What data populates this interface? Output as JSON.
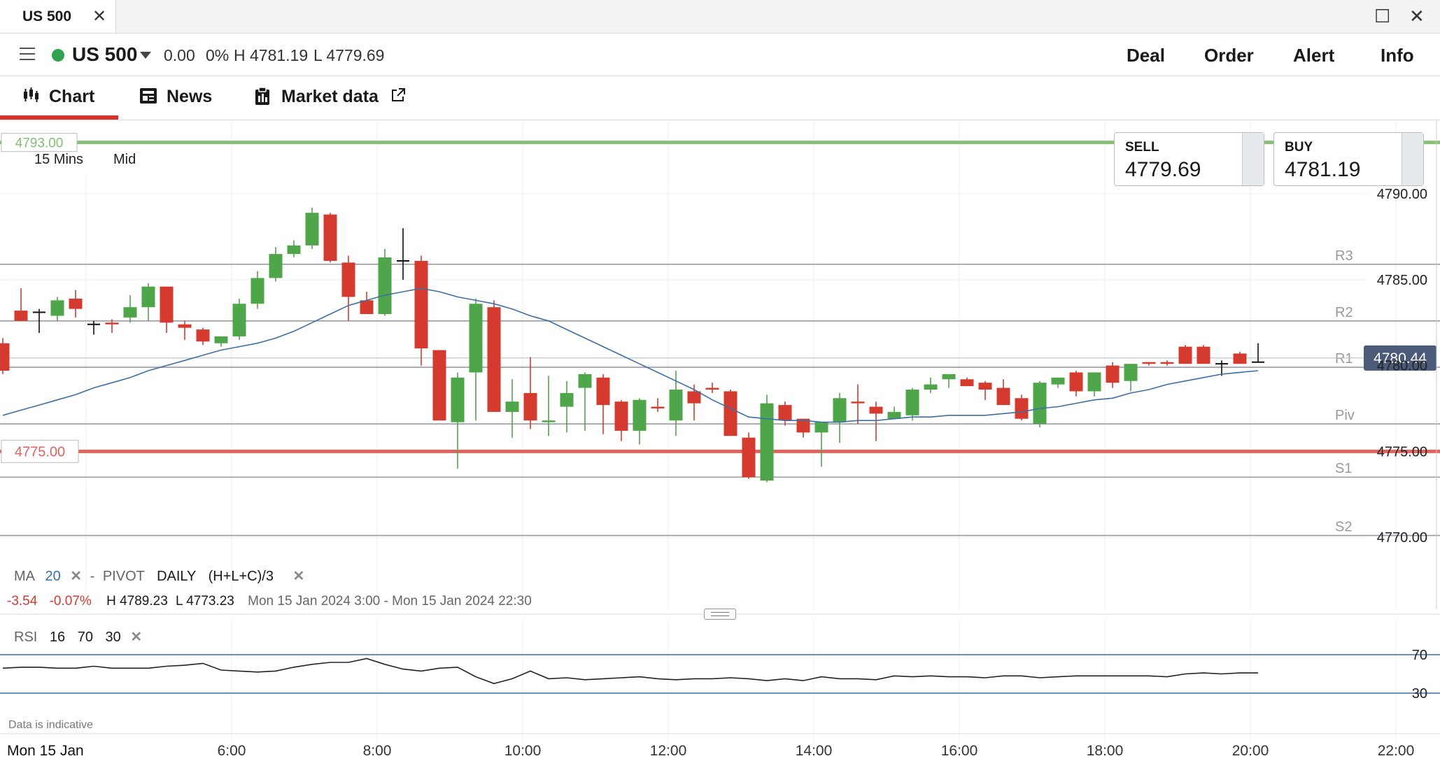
{
  "window": {
    "tab_title": "US 500",
    "close_glyph": "✕",
    "maximize_glyph": "☐",
    "window_close_glyph": "✕"
  },
  "header": {
    "instrument": "US 500",
    "change": "0.00",
    "change_pct": "0%",
    "high": "H 4781.19",
    "low": "L 4779.69",
    "actions": [
      "Deal",
      "Order",
      "Alert",
      "Info"
    ],
    "status_color": "#2ea44f"
  },
  "tabs": [
    {
      "label": "Chart",
      "icon": "candlestick-icon",
      "active": true
    },
    {
      "label": "News",
      "icon": "newspaper-icon"
    },
    {
      "label": "Market data",
      "icon": "clipboard-icon",
      "external": "external-link-icon"
    }
  ],
  "ticket": {
    "sell_label": "SELL",
    "sell_price": "4779.69",
    "buy_label": "BUY",
    "buy_price": "4781.19"
  },
  "toolbar": {
    "timeframe": "15 Mins",
    "price_type": "Mid"
  },
  "indicators": {
    "ma_label": "MA",
    "ma_period": "20",
    "pivot_label": "PIVOT",
    "pivot_period": "DAILY",
    "pivot_formula": "(H+L+C)/3",
    "change": "-3.54",
    "change_pct": "-0.07%",
    "high": "H 4789.23",
    "low": "L 4773.23",
    "range": "Mon 15 Jan 2024 3:00 - Mon 15 Jan 2024 22:30",
    "rsi_label": "RSI",
    "rsi_period": "16",
    "rsi_upper": "70",
    "rsi_lower": "30"
  },
  "footer": {
    "note": "Data is indicative",
    "date_label": "Mon 15 Jan"
  },
  "chart_data": {
    "type": "candlestick",
    "interval": "15 Mins",
    "ylim": [
      4767.8,
      4793.8
    ],
    "y_ticks": [
      "4790.00",
      "4785.00",
      "4780.00",
      "4775.00",
      "4770.00"
    ],
    "x_ticks": [
      "6:00",
      "8:00",
      "10:00",
      "12:00",
      "14:00",
      "16:00",
      "18:00",
      "20:00",
      "22:00"
    ],
    "horizontal_levels": [
      {
        "label": "4793.00",
        "value": 4793.0,
        "color": "#86bf75"
      },
      {
        "label": "4775.00",
        "value": 4775.0,
        "color": "#e0635e"
      },
      {
        "label": "4780.44",
        "value": 4780.44,
        "color": "#4a5a78"
      }
    ],
    "pivots": [
      {
        "name": "R3",
        "value": 4785.9
      },
      {
        "name": "R2",
        "value": 4782.6
      },
      {
        "name": "R1",
        "value": 4779.9
      },
      {
        "name": "Piv",
        "value": 4776.6
      },
      {
        "name": "S1",
        "value": 4773.5
      },
      {
        "name": "S2",
        "value": 4770.1
      }
    ],
    "colors": {
      "up": "#4ea54a",
      "down": "#d53a2e",
      "ma": "#3d6fa3",
      "rsi": "#222222"
    },
    "candles": [
      {
        "o": 4781.3,
        "h": 4781.6,
        "l": 4779.5,
        "c": 4779.7
      },
      {
        "o": 4783.2,
        "h": 4784.5,
        "l": 4782.6,
        "c": 4782.6
      },
      {
        "o": 4783.1,
        "h": 4783.3,
        "l": 4781.9,
        "c": 4783.1
      },
      {
        "o": 4782.9,
        "h": 4784.0,
        "l": 4782.6,
        "c": 4783.8
      },
      {
        "o": 4783.9,
        "h": 4784.4,
        "l": 4782.8,
        "c": 4783.3
      },
      {
        "o": 4782.4,
        "h": 4782.6,
        "l": 4781.8,
        "c": 4782.4
      },
      {
        "o": 4782.5,
        "h": 4782.7,
        "l": 4781.9,
        "c": 4782.4
      },
      {
        "o": 4782.8,
        "h": 4784.1,
        "l": 4782.5,
        "c": 4783.4
      },
      {
        "o": 4783.4,
        "h": 4784.8,
        "l": 4782.6,
        "c": 4784.6
      },
      {
        "o": 4784.6,
        "h": 4784.6,
        "l": 4781.9,
        "c": 4782.5
      },
      {
        "o": 4782.4,
        "h": 4782.6,
        "l": 4781.5,
        "c": 4782.2
      },
      {
        "o": 4782.1,
        "h": 4782.2,
        "l": 4781.2,
        "c": 4781.4
      },
      {
        "o": 4781.3,
        "h": 4781.7,
        "l": 4781.1,
        "c": 4781.7
      },
      {
        "o": 4781.7,
        "h": 4783.9,
        "l": 4781.5,
        "c": 4783.6
      },
      {
        "o": 4783.6,
        "h": 4785.5,
        "l": 4783.3,
        "c": 4785.1
      },
      {
        "o": 4785.1,
        "h": 4786.9,
        "l": 4784.9,
        "c": 4786.5
      },
      {
        "o": 4786.5,
        "h": 4787.3,
        "l": 4786.3,
        "c": 4787.0
      },
      {
        "o": 4787.0,
        "h": 4789.2,
        "l": 4786.8,
        "c": 4788.9
      },
      {
        "o": 4788.8,
        "h": 4788.9,
        "l": 4786.0,
        "c": 4786.1
      },
      {
        "o": 4786.0,
        "h": 4786.4,
        "l": 4782.6,
        "c": 4784.0
      },
      {
        "o": 4783.8,
        "h": 4784.3,
        "l": 4783.0,
        "c": 4783.0
      },
      {
        "o": 4783.0,
        "h": 4786.8,
        "l": 4782.9,
        "c": 4786.3
      },
      {
        "o": 4786.1,
        "h": 4788.0,
        "l": 4785.0,
        "c": 4786.1
      },
      {
        "o": 4786.1,
        "h": 4786.4,
        "l": 4780.0,
        "c": 4781.0
      },
      {
        "o": 4780.9,
        "h": 4780.9,
        "l": 4776.8,
        "c": 4776.8
      },
      {
        "o": 4776.7,
        "h": 4779.6,
        "l": 4774.0,
        "c": 4779.3
      },
      {
        "o": 4779.6,
        "h": 4783.9,
        "l": 4776.8,
        "c": 4783.6
      },
      {
        "o": 4783.4,
        "h": 4783.8,
        "l": 4777.3,
        "c": 4777.3
      },
      {
        "o": 4777.3,
        "h": 4779.2,
        "l": 4775.8,
        "c": 4777.9
      },
      {
        "o": 4778.4,
        "h": 4780.5,
        "l": 4776.3,
        "c": 4776.8
      },
      {
        "o": 4776.7,
        "h": 4779.4,
        "l": 4775.9,
        "c": 4776.8
      },
      {
        "o": 4777.6,
        "h": 4779.1,
        "l": 4776.1,
        "c": 4778.4
      },
      {
        "o": 4778.7,
        "h": 4779.6,
        "l": 4776.2,
        "c": 4779.5
      },
      {
        "o": 4779.3,
        "h": 4779.5,
        "l": 4776.0,
        "c": 4777.7
      },
      {
        "o": 4777.9,
        "h": 4778.0,
        "l": 4775.6,
        "c": 4776.2
      },
      {
        "o": 4776.2,
        "h": 4778.1,
        "l": 4775.4,
        "c": 4778.0
      },
      {
        "o": 4777.6,
        "h": 4778.1,
        "l": 4777.3,
        "c": 4777.5
      },
      {
        "o": 4776.8,
        "h": 4779.7,
        "l": 4775.9,
        "c": 4778.6
      },
      {
        "o": 4778.5,
        "h": 4778.9,
        "l": 4776.8,
        "c": 4777.8
      },
      {
        "o": 4778.7,
        "h": 4779.0,
        "l": 4778.4,
        "c": 4778.6
      },
      {
        "o": 4778.5,
        "h": 4778.6,
        "l": 4775.9,
        "c": 4775.9
      },
      {
        "o": 4775.8,
        "h": 4776.1,
        "l": 4773.4,
        "c": 4773.5
      },
      {
        "o": 4773.3,
        "h": 4778.3,
        "l": 4773.2,
        "c": 4777.8
      },
      {
        "o": 4777.7,
        "h": 4777.9,
        "l": 4776.5,
        "c": 4776.8
      },
      {
        "o": 4776.9,
        "h": 4776.9,
        "l": 4775.8,
        "c": 4776.1
      },
      {
        "o": 4776.1,
        "h": 4776.7,
        "l": 4774.1,
        "c": 4776.7
      },
      {
        "o": 4776.7,
        "h": 4778.4,
        "l": 4775.5,
        "c": 4778.1
      },
      {
        "o": 4777.9,
        "h": 4778.9,
        "l": 4776.6,
        "c": 4777.8
      },
      {
        "o": 4777.6,
        "h": 4777.9,
        "l": 4775.6,
        "c": 4777.2
      },
      {
        "o": 4776.9,
        "h": 4777.6,
        "l": 4776.9,
        "c": 4777.3
      },
      {
        "o": 4777.1,
        "h": 4778.7,
        "l": 4776.8,
        "c": 4778.6
      },
      {
        "o": 4778.6,
        "h": 4779.3,
        "l": 4778.4,
        "c": 4778.9
      },
      {
        "o": 4779.2,
        "h": 4779.4,
        "l": 4778.7,
        "c": 4779.5
      },
      {
        "o": 4779.2,
        "h": 4779.3,
        "l": 4778.8,
        "c": 4778.8
      },
      {
        "o": 4779.0,
        "h": 4779.1,
        "l": 4778.0,
        "c": 4778.6
      },
      {
        "o": 4778.7,
        "h": 4779.2,
        "l": 4777.7,
        "c": 4777.7
      },
      {
        "o": 4778.1,
        "h": 4778.3,
        "l": 4776.8,
        "c": 4776.9
      },
      {
        "o": 4776.6,
        "h": 4779.1,
        "l": 4776.4,
        "c": 4779.0
      },
      {
        "o": 4778.9,
        "h": 4779.3,
        "l": 4778.7,
        "c": 4779.3
      },
      {
        "o": 4779.6,
        "h": 4779.7,
        "l": 4778.2,
        "c": 4778.5
      },
      {
        "o": 4778.5,
        "h": 4779.6,
        "l": 4778.2,
        "c": 4779.6
      },
      {
        "o": 4780.0,
        "h": 4780.2,
        "l": 4778.7,
        "c": 4779.0
      },
      {
        "o": 4779.1,
        "h": 4780.1,
        "l": 4778.5,
        "c": 4780.1
      },
      {
        "o": 4780.2,
        "h": 4780.2,
        "l": 4780.0,
        "c": 4780.1
      },
      {
        "o": 4780.2,
        "h": 4780.3,
        "l": 4780.0,
        "c": 4780.1
      },
      {
        "o": 4781.1,
        "h": 4781.2,
        "l": 4780.1,
        "c": 4780.1
      },
      {
        "o": 4781.1,
        "h": 4781.2,
        "l": 4780.1,
        "c": 4780.1
      },
      {
        "o": 4780.1,
        "h": 4780.3,
        "l": 4779.4,
        "c": 4780.1
      },
      {
        "o": 4780.7,
        "h": 4780.8,
        "l": 4780.1,
        "c": 4780.1
      },
      {
        "o": 4780.2,
        "h": 4781.3,
        "l": 4780.2,
        "c": 4780.2
      }
    ],
    "ma_values": [
      4777.1,
      4777.4,
      4777.7,
      4778.0,
      4778.3,
      4778.7,
      4779.0,
      4779.3,
      4779.7,
      4780.0,
      4780.3,
      4780.6,
      4780.9,
      4781.1,
      4781.3,
      4781.6,
      4782.0,
      4782.5,
      4783.0,
      4783.5,
      4783.8,
      4784.1,
      4784.3,
      4784.5,
      4784.3,
      4784.0,
      4783.8,
      4783.6,
      4783.3,
      4782.9,
      4782.6,
      4782.1,
      4781.6,
      4781.1,
      4780.6,
      4780.1,
      4779.6,
      4779.1,
      4778.6,
      4778.0,
      4777.5,
      4777.0,
      4776.9,
      4776.8,
      4776.8,
      4776.7,
      4776.7,
      4776.8,
      4776.8,
      4776.9,
      4777.0,
      4777.0,
      4777.1,
      4777.1,
      4777.1,
      4777.2,
      4777.3,
      4777.5,
      4777.6,
      4777.8,
      4778.0,
      4778.1,
      4778.4,
      4778.6,
      4778.9,
      4779.1,
      4779.3,
      4779.5,
      4779.6,
      4779.7
    ],
    "rsi_values": [
      56,
      57,
      57,
      56,
      56,
      58,
      56,
      56,
      56,
      58,
      59,
      61,
      54,
      53,
      52,
      53,
      57,
      60,
      62,
      62,
      66,
      60,
      55,
      53,
      56,
      57,
      47,
      40,
      45,
      53,
      45,
      46,
      44,
      45,
      46,
      47,
      45,
      44,
      45,
      45,
      46,
      45,
      43,
      45,
      43,
      47,
      45,
      45,
      44,
      48,
      47,
      48,
      47,
      47,
      46,
      48,
      48,
      46,
      47,
      48,
      48,
      48,
      48,
      48,
      47,
      50,
      51,
      50,
      51,
      51
    ]
  }
}
